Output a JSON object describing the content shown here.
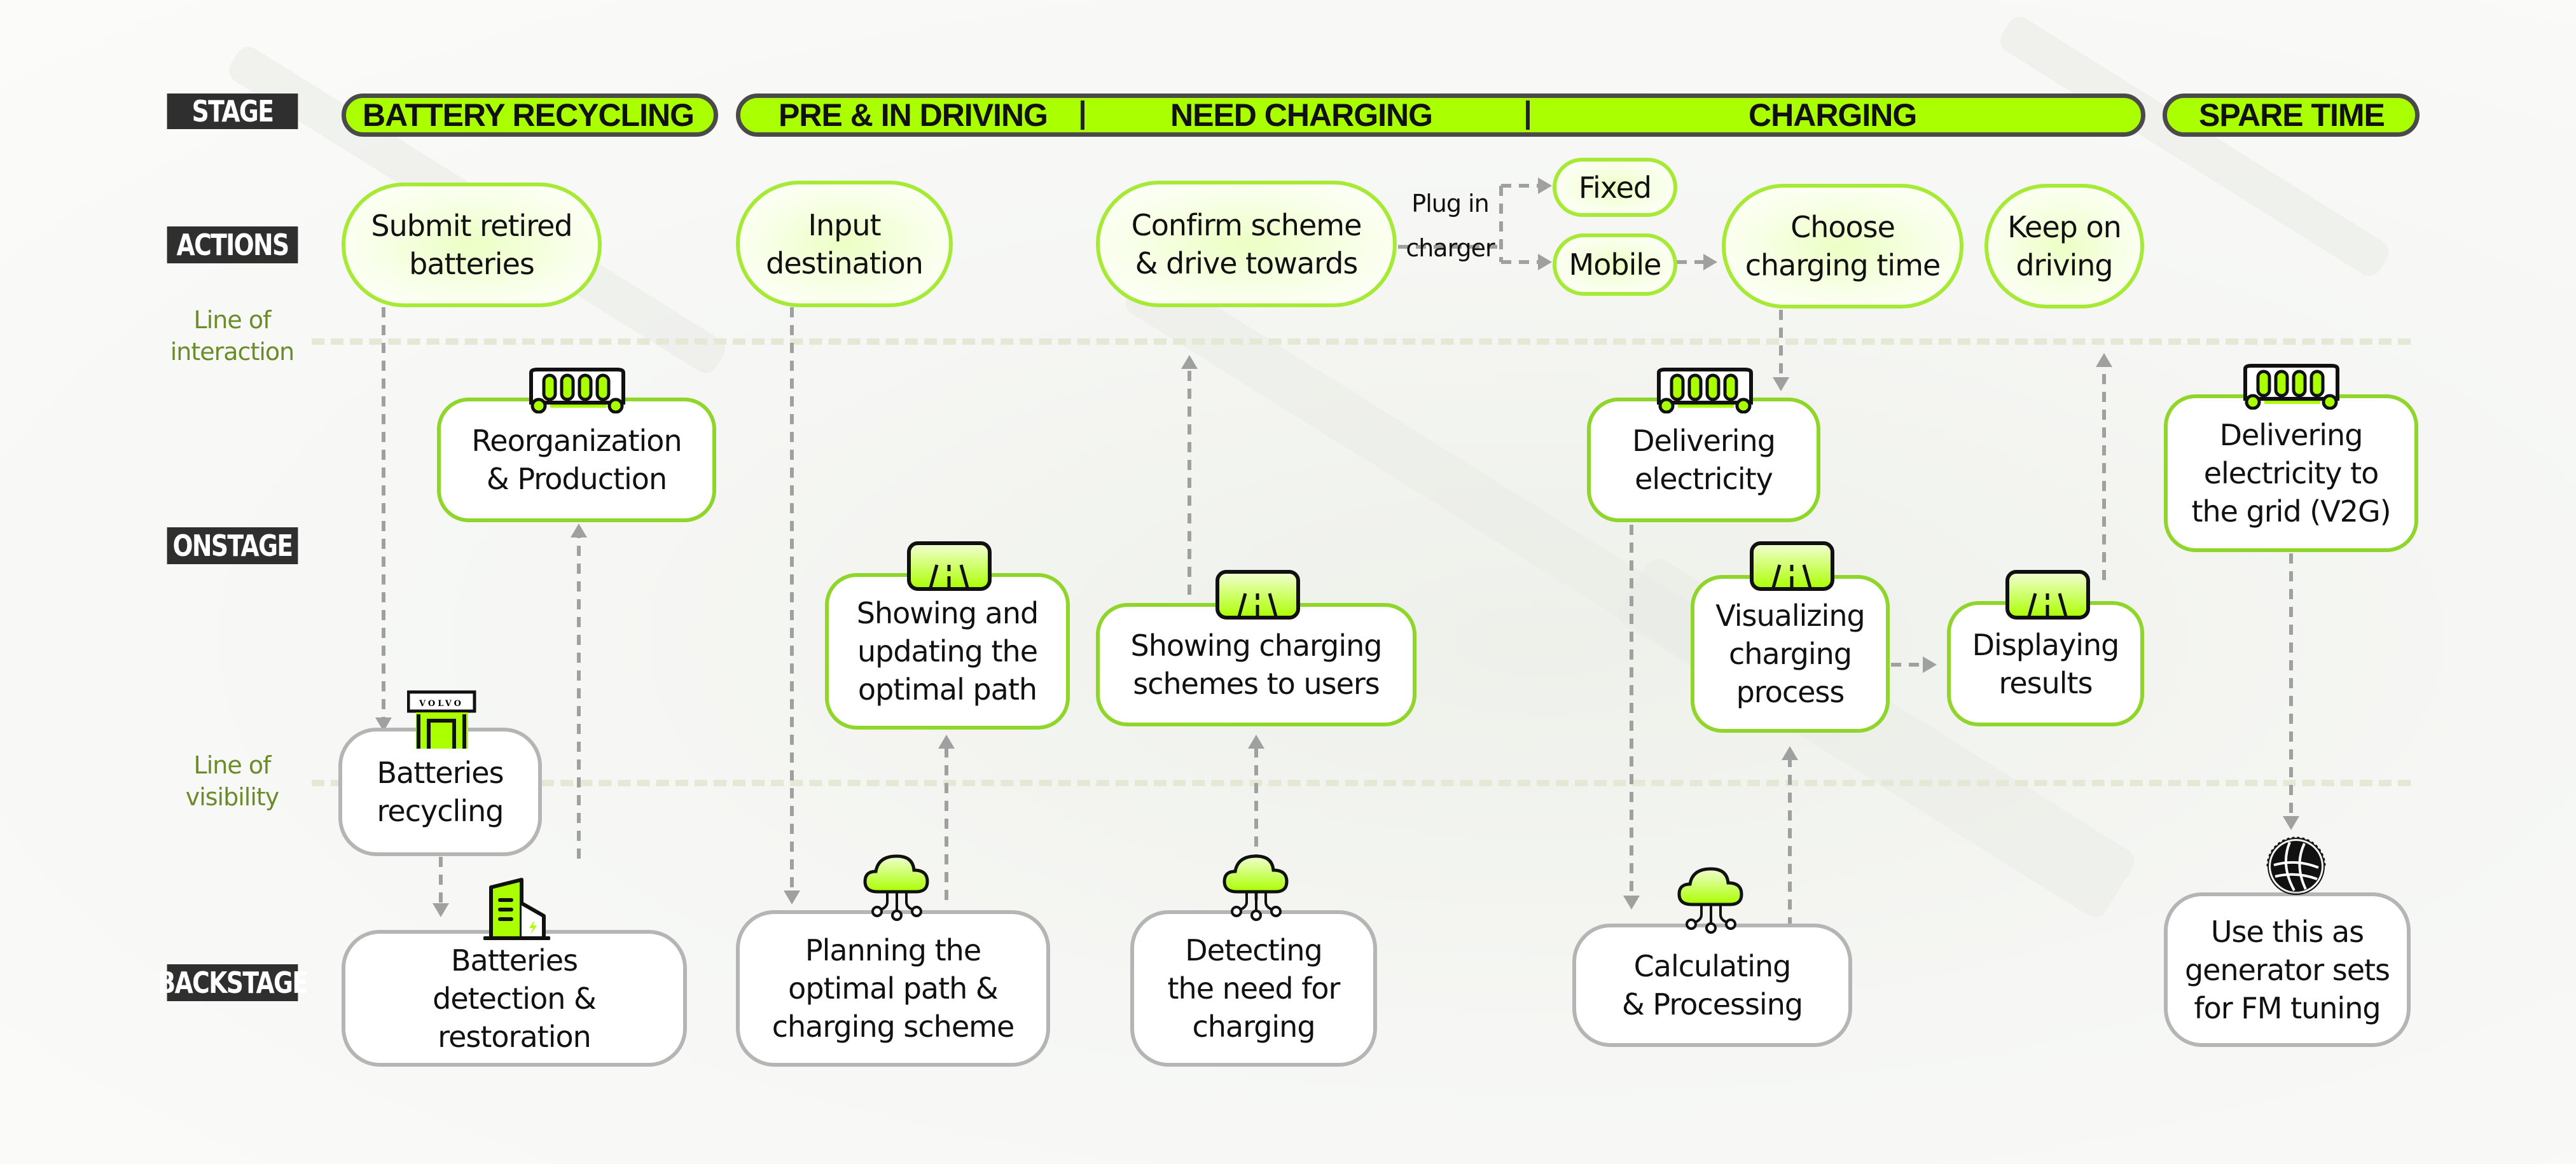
{
  "row_labels": {
    "stage": "STAGE",
    "actions": "ACTIONS",
    "onstage": "ONSTAGE",
    "backstage": "BACKSTAGE"
  },
  "lines": {
    "interaction": [
      "Line of",
      "interaction"
    ],
    "visibility": [
      "Line of",
      "visibility"
    ]
  },
  "stages": {
    "battery_recycling": "BATTERY RECYCLING",
    "pre_in_driving": "PRE & IN DRIVING",
    "need_charging": "NEED CHARGING",
    "charging": "CHARGING",
    "spare_time": "SPARE TIME"
  },
  "actions": {
    "submit": [
      "Submit retired",
      "batteries"
    ],
    "input": [
      "Input",
      "destination"
    ],
    "confirm": [
      "Confirm scheme",
      "& drive towards"
    ],
    "plug_in": [
      "Plug in",
      "charger"
    ],
    "fixed": "Fixed",
    "mobile": "Mobile",
    "choose": [
      "Choose",
      "charging time"
    ],
    "keep": [
      "Keep on",
      "driving"
    ]
  },
  "onstage": {
    "reorg": [
      "Reorganization",
      "& Production"
    ],
    "delivering": [
      "Delivering",
      "electricity"
    ],
    "v2g": [
      "Delivering",
      "electricity to",
      "the grid (V2G)"
    ],
    "showing_updating": [
      "Showing and",
      "updating the",
      "optimal path"
    ],
    "showing_schemes": [
      "Showing charging",
      "schemes to users"
    ],
    "visualizing": [
      "Visualizing",
      "charging",
      "process"
    ],
    "displaying": [
      "Displaying",
      "results"
    ],
    "recycling": [
      "Batteries",
      "recycling"
    ]
  },
  "backstage": {
    "detection": [
      "Batteries",
      "detection &",
      "restoration"
    ],
    "planning": [
      "Planning the",
      "optimal path &",
      "charging scheme"
    ],
    "detecting": [
      "Detecting",
      "the need for",
      "charging"
    ],
    "calculating": [
      "Calculating",
      "& Processing"
    ],
    "generator": [
      "Use this as",
      "generator sets",
      "for FM tuning"
    ]
  },
  "icons": {
    "bus": "bus-icon",
    "road": "road-display-icon",
    "cloud": "cloud-network-icon",
    "store": "volvo-store-icon",
    "store_sign": "VOLVO",
    "factory": "battery-factory-icon",
    "grid_logo": "state-grid-logo"
  },
  "colors": {
    "accent": "#aaff00",
    "action_border": "#a6ea35",
    "onstage_border": "#8fd52a",
    "backstage_border": "#b5b5b5",
    "label_bg": "#2f2f2f",
    "line_label": "#6a8c2a",
    "connector": "#a0a0a0"
  }
}
